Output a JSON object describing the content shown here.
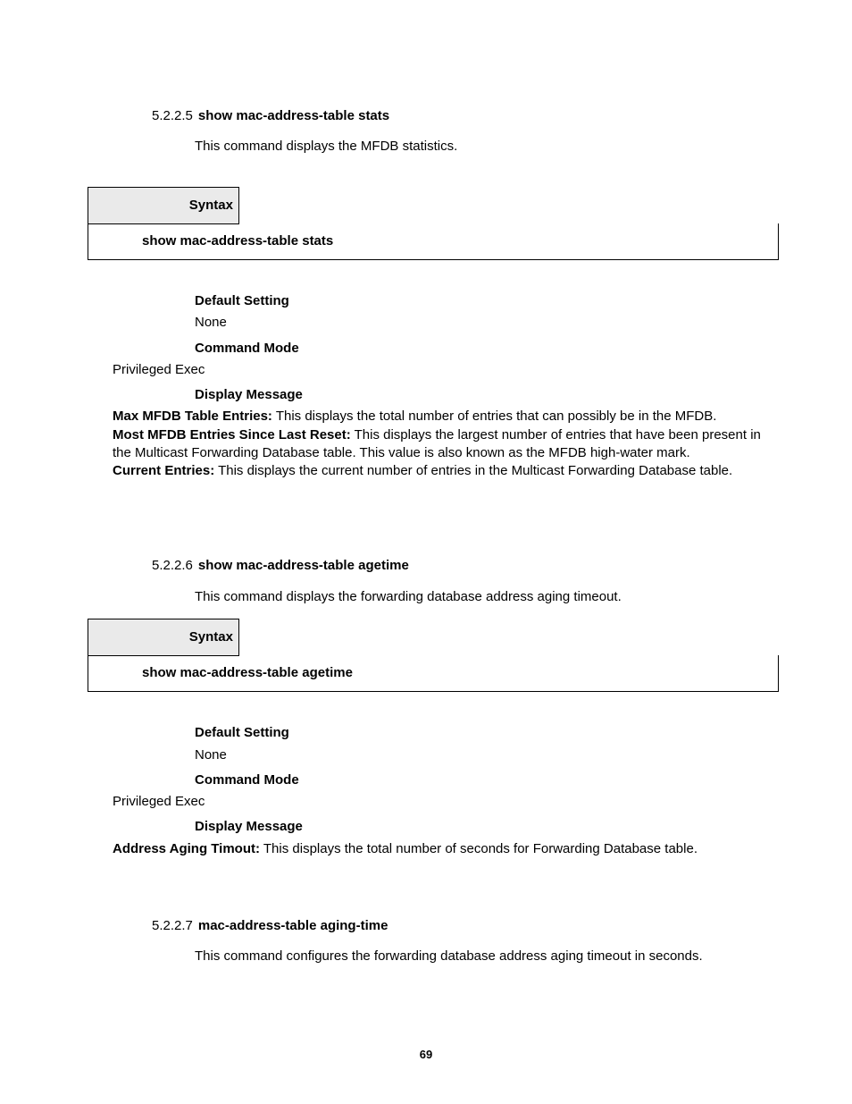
{
  "page_number": "69",
  "sections": {
    "s1": {
      "num": "5.2.2.5",
      "title": "show mac-address-table stats",
      "intro": "This command displays the MFDB statistics.",
      "syntax_label": "Syntax",
      "syntax_cmd": "show mac-address-table stats",
      "default_setting_label": "Default Setting",
      "default_setting_value": "None",
      "command_mode_label": "Command Mode",
      "command_mode_value": "Privileged Exec",
      "display_message_label": "Display Message",
      "msg1_label": "Max MFDB Table Entries:",
      "msg1_text": " This displays the total number of entries that can possibly be in the MFDB.",
      "msg2_label": "Most MFDB Entries Since Last Reset:",
      "msg2_text": " This displays the largest number of entries that have been present in the Multicast Forwarding Database table. This value is also known as the MFDB high-water mark.",
      "msg3_label": "Current Entries:",
      "msg3_text": " This displays the current number of entries in the Multicast Forwarding Database table."
    },
    "s2": {
      "num": "5.2.2.6",
      "title": "show mac-address-table agetime",
      "intro": "This command displays the forwarding database address aging timeout.",
      "syntax_label": "Syntax",
      "syntax_cmd": "show mac-address-table agetime",
      "default_setting_label": "Default Setting",
      "default_setting_value": "None",
      "command_mode_label": "Command Mode",
      "command_mode_value": "Privileged Exec",
      "display_message_label": "Display Message",
      "msg1_label": "Address Aging Timout:",
      "msg1_text": " This displays the total number of seconds for Forwarding Database table."
    },
    "s3": {
      "num": "5.2.2.7",
      "title": "mac-address-table aging-time",
      "intro": "This command configures the forwarding database address aging timeout in seconds."
    }
  }
}
